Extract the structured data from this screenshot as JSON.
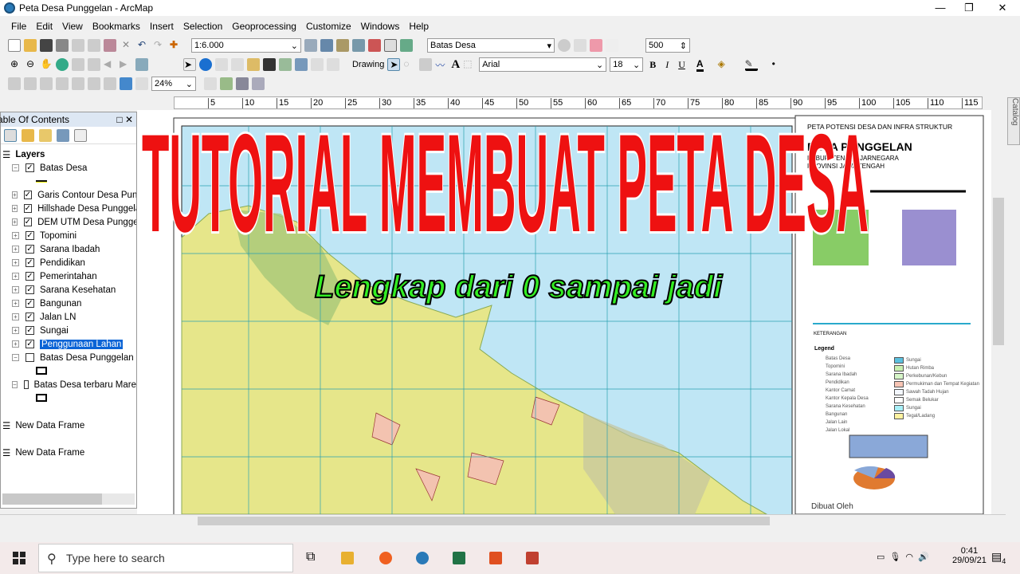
{
  "window": {
    "title": "Peta Desa Punggelan - ArcMap",
    "minimize": "—",
    "maximize": "❐",
    "close": "✕"
  },
  "menu": [
    "File",
    "Edit",
    "View",
    "Bookmarks",
    "Insert",
    "Selection",
    "Geoprocessing",
    "Customize",
    "Windows",
    "Help"
  ],
  "toolbar": {
    "scale": "1:6.000",
    "layer_select": "Batas Desa",
    "value_500": "500",
    "zoom_percent": "24%",
    "drawing_label": "Drawing",
    "font": "Arial",
    "font_size": "18",
    "bold": "B",
    "italic": "I",
    "underline": "U",
    "text_tool": "A"
  },
  "ruler": [
    "5",
    "10",
    "15",
    "20",
    "25",
    "30",
    "35",
    "40",
    "45",
    "50",
    "55",
    "60",
    "65",
    "70",
    "75",
    "80",
    "85",
    "90",
    "95",
    "100",
    "105",
    "110",
    "115"
  ],
  "toc": {
    "title": "Table Of Contents",
    "root": "Layers",
    "layers": [
      {
        "name": "Batas Desa",
        "checked": true,
        "expanded": true
      },
      {
        "name": "Garis Contour Desa Punggelan",
        "checked": true
      },
      {
        "name": "Hillshade Desa Punggelan",
        "checked": true
      },
      {
        "name": "DEM UTM Desa Punggelan",
        "checked": true
      },
      {
        "name": "Topomini",
        "checked": true
      },
      {
        "name": "Sarana Ibadah",
        "checked": true
      },
      {
        "name": "Pendidikan",
        "checked": true
      },
      {
        "name": "Pemerintahan",
        "checked": true
      },
      {
        "name": "Sarana Kesehatan",
        "checked": true
      },
      {
        "name": "Bangunan",
        "checked": true
      },
      {
        "name": "Jalan LN",
        "checked": true
      },
      {
        "name": "Sungai",
        "checked": true
      },
      {
        "name": "Penggunaan Lahan",
        "checked": true,
        "selected": true
      },
      {
        "name": "Batas Desa Punggelan",
        "checked": false,
        "expanded": true
      },
      {
        "name": "Batas Desa terbaru Mare",
        "checked": false,
        "expanded": true
      }
    ],
    "frames": [
      "New Data Frame",
      "New Data Frame"
    ]
  },
  "overlay": {
    "title": "TUTORIAL MEMBUAT PETA DESA",
    "subtitle": "Lengkap dari 0 sampai jadi",
    "title_color": "#ee1111",
    "subtitle_color": "#33ee22"
  },
  "layout": {
    "header": "PETA POTENSI DESA DAN INFRA STRUKTUR",
    "village": "DESA PUNGGELAN",
    "regency": "KABUPATEN BANJARNEGARA",
    "province": "PROVINSI JAWA TENGAH",
    "keterangan": "KETERANGAN",
    "legend_title": "Legend",
    "legend_left": [
      "Batas Desa",
      "Topomini",
      "Sarana Ibadah",
      "Pendidikan",
      "Kantor Camat",
      "Kantor Kepala Desa",
      "Sarana Kesehatan",
      "Bangunan",
      "Jalan Lain",
      "Jalan Lokal"
    ],
    "legend_right": [
      {
        "label": "Sungai",
        "color": "#5bc0de"
      },
      {
        "label": "Hutan Rimba",
        "color": "#c8f0b0"
      },
      {
        "label": "Perkebunan/Kebun",
        "color": "#d6f5c8"
      },
      {
        "label": "Permukiman dan Tempat Kegiatan",
        "color": "#f7c4b4"
      },
      {
        "label": "Sawah Tadah Hujan",
        "color": "#f4f8ff"
      },
      {
        "label": "Semak Belukar",
        "color": "#ffffff"
      },
      {
        "label": "Sungai",
        "color": "#a8f0f8"
      },
      {
        "label": "Tegal/Ladang",
        "color": "#fff2a0"
      }
    ],
    "made_by": "Dibuat Oleh"
  },
  "taskbar": {
    "search_placeholder": "Type here to search",
    "time": "0:41",
    "date": "29/09/21",
    "notifications": "4"
  },
  "colors": {
    "sea": "#bfe6f5",
    "land": "#e6e68a",
    "selection": "#0a64d6"
  }
}
